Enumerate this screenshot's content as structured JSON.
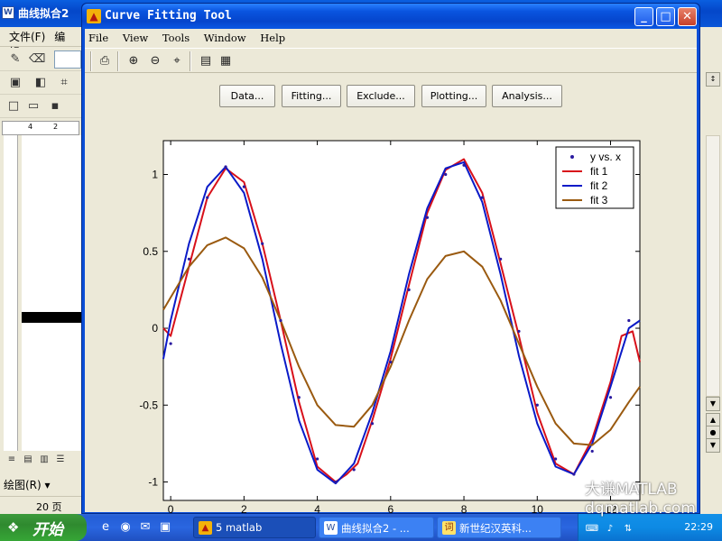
{
  "background_window": {
    "title": "曲线拟合2",
    "menu": [
      "文件(F)",
      "编辑"
    ],
    "ruler_marks": [
      "4",
      "2"
    ],
    "draw_label": "绘图(R)",
    "page_label": "20 页"
  },
  "cft_window": {
    "title": "Curve Fitting Tool",
    "menu": [
      "File",
      "View",
      "Tools",
      "Window",
      "Help"
    ],
    "action_buttons": [
      "Data...",
      "Fitting...",
      "Exclude...",
      "Plotting...",
      "Analysis..."
    ]
  },
  "chart_data": {
    "type": "line",
    "xlim": [
      -0.2,
      12.8
    ],
    "ylim": [
      -1.12,
      1.22
    ],
    "xticks": [
      0,
      2,
      4,
      6,
      8,
      10,
      12
    ],
    "xtick_labels": [
      "0",
      "2",
      "4",
      "6",
      "8",
      "10",
      "12"
    ],
    "yticks": [
      -1,
      -0.5,
      0,
      0.5,
      1
    ],
    "ytick_labels": [
      "-1",
      "-0.5",
      "0",
      "0.5",
      "1"
    ],
    "legend_position": "top-right",
    "series": [
      {
        "name": "y vs. x",
        "color": "#2a1aa0",
        "style": "dots",
        "x": [
          0.0,
          0.5,
          1.0,
          1.5,
          2.0,
          2.5,
          3.0,
          3.5,
          4.0,
          4.5,
          5.0,
          5.5,
          6.0,
          6.5,
          7.0,
          7.5,
          8.0,
          8.5,
          9.0,
          9.5,
          10.0,
          10.5,
          11.0,
          11.5,
          12.0,
          12.5
        ],
        "y": [
          -0.1,
          0.45,
          0.85,
          1.05,
          0.92,
          0.55,
          0.05,
          -0.45,
          -0.85,
          -1.0,
          -0.92,
          -0.62,
          -0.22,
          0.25,
          0.72,
          1.0,
          1.06,
          0.85,
          0.45,
          -0.02,
          -0.5,
          -0.85,
          -0.95,
          -0.8,
          -0.45,
          0.05
        ]
      },
      {
        "name": "fit 1",
        "color": "#d8101a",
        "style": "line",
        "x": [
          -0.2,
          0.0,
          0.5,
          1.0,
          1.5,
          2.0,
          2.5,
          3.0,
          3.5,
          4.0,
          4.5,
          4.8,
          5.1,
          5.5,
          6.0,
          6.5,
          7.0,
          7.5,
          8.0,
          8.5,
          9.0,
          9.5,
          10.0,
          10.5,
          11.0,
          11.5,
          12.0,
          12.3,
          12.6,
          12.8
        ],
        "y": [
          0.0,
          -0.05,
          0.4,
          0.85,
          1.04,
          0.95,
          0.55,
          0.05,
          -0.48,
          -0.9,
          -1.0,
          -0.95,
          -0.88,
          -0.6,
          -0.2,
          0.28,
          0.75,
          1.03,
          1.1,
          0.88,
          0.42,
          -0.05,
          -0.55,
          -0.88,
          -0.95,
          -0.72,
          -0.35,
          -0.05,
          -0.02,
          -0.22
        ]
      },
      {
        "name": "fit 2",
        "color": "#0a1ac8",
        "style": "line",
        "x": [
          -0.2,
          0.0,
          0.5,
          1.0,
          1.5,
          2.0,
          2.5,
          3.0,
          3.5,
          4.0,
          4.5,
          5.0,
          5.5,
          6.0,
          6.5,
          7.0,
          7.5,
          8.0,
          8.5,
          9.0,
          9.5,
          10.0,
          10.5,
          11.0,
          11.5,
          12.0,
          12.5,
          12.8
        ],
        "y": [
          -0.2,
          0.05,
          0.55,
          0.92,
          1.05,
          0.88,
          0.45,
          -0.1,
          -0.6,
          -0.92,
          -1.01,
          -0.88,
          -0.55,
          -0.15,
          0.35,
          0.78,
          1.04,
          1.08,
          0.82,
          0.35,
          -0.18,
          -0.62,
          -0.9,
          -0.95,
          -0.75,
          -0.38,
          0.0,
          0.05
        ]
      },
      {
        "name": "fit 3",
        "color": "#9a5a10",
        "style": "line",
        "x": [
          -0.2,
          0.0,
          0.5,
          1.0,
          1.5,
          2.0,
          2.5,
          3.0,
          3.5,
          4.0,
          4.5,
          5.0,
          5.5,
          6.0,
          6.5,
          7.0,
          7.5,
          8.0,
          8.5,
          9.0,
          9.5,
          10.0,
          10.5,
          11.0,
          11.5,
          12.0,
          12.5,
          12.8
        ],
        "y": [
          0.12,
          0.2,
          0.4,
          0.54,
          0.59,
          0.52,
          0.33,
          0.05,
          -0.25,
          -0.5,
          -0.63,
          -0.64,
          -0.5,
          -0.25,
          0.05,
          0.32,
          0.47,
          0.5,
          0.4,
          0.18,
          -0.1,
          -0.38,
          -0.62,
          -0.75,
          -0.76,
          -0.66,
          -0.48,
          -0.38
        ]
      }
    ]
  },
  "taskbar": {
    "start_label": "开始",
    "tasks": [
      "5 matlab",
      "曲线拟合2 - ...",
      "新世纪汉英科..."
    ],
    "clock": "22:29"
  },
  "watermark": {
    "line1": "大谦MATLAB",
    "line2": "dqmatlab.com"
  }
}
